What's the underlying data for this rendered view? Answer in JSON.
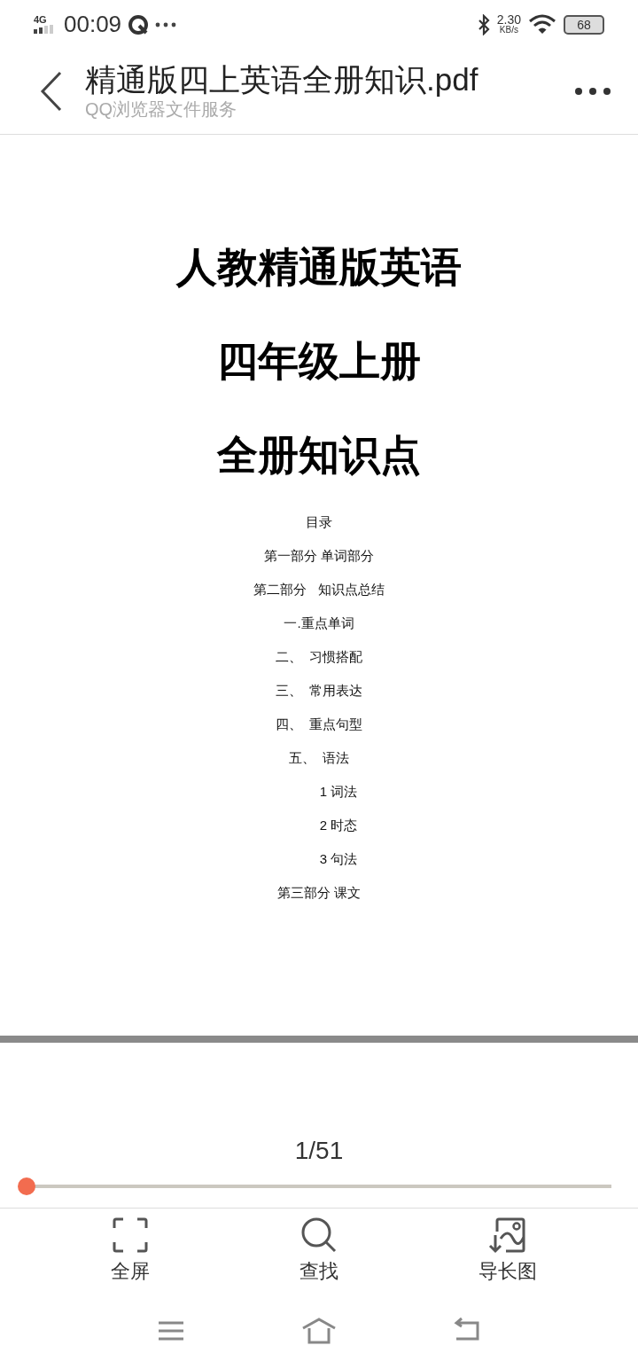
{
  "status_bar": {
    "network": "4G",
    "time": "00:09",
    "speed_value": "2.30",
    "speed_unit": "KB/s",
    "battery": "68"
  },
  "header": {
    "title": "精通版四上英语全册知识.pdf",
    "subtitle": "QQ浏览器文件服务"
  },
  "document": {
    "title_lines": [
      "人教精通版英语",
      "四年级上册",
      "全册知识点"
    ],
    "toc": [
      {
        "text": "目录"
      },
      {
        "text": "第一部分 单词部分"
      },
      {
        "text": "第二部分   知识点总结"
      },
      {
        "text": "一.重点单词"
      },
      {
        "text": "二、  习惯搭配"
      },
      {
        "text": "三、  常用表达"
      },
      {
        "text": "四、  重点句型"
      },
      {
        "text": "五、  语法",
        "children": [
          {
            "text": "1 词法"
          },
          {
            "text": "2 时态"
          },
          {
            "text": "3 句法"
          }
        ]
      },
      {
        "text": "第三部分 课文"
      }
    ]
  },
  "pager": {
    "label": "1/51",
    "level": 0.0
  },
  "toolbar": [
    {
      "kind": "fullscreen",
      "label": "全屏"
    },
    {
      "kind": "search",
      "label": "查找"
    },
    {
      "kind": "longimage",
      "label": "导长图"
    }
  ],
  "nav_bar": [
    {
      "kind": "menu"
    },
    {
      "kind": "home"
    },
    {
      "kind": "back"
    }
  ]
}
